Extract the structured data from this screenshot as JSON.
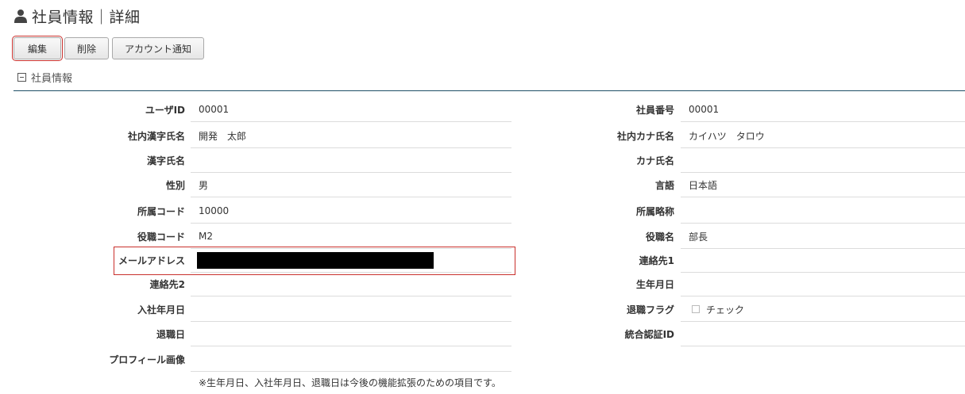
{
  "header": {
    "title": "社員情報｜詳細",
    "icon": "user-icon"
  },
  "toolbar": {
    "edit_label": "編集",
    "delete_label": "削除",
    "notify_label": "アカウント通知"
  },
  "section": {
    "label": "社員情報",
    "icon": "collapse-minus-icon"
  },
  "left_fields": [
    {
      "label": "ユーザID",
      "value": "00001"
    },
    {
      "label": "社内漢字氏名",
      "value": "開発　太郎"
    },
    {
      "label": "漢字氏名",
      "value": ""
    },
    {
      "label": "性別",
      "value": "男"
    },
    {
      "label": "所属コード",
      "value": "10000"
    },
    {
      "label": "役職コード",
      "value": "M2"
    },
    {
      "label": "メールアドレス",
      "value": ""
    },
    {
      "label": "連絡先2",
      "value": ""
    },
    {
      "label": "入社年月日",
      "value": ""
    },
    {
      "label": "退職日",
      "value": ""
    },
    {
      "label": "プロフィール画像",
      "value": ""
    }
  ],
  "right_fields": [
    {
      "label": "社員番号",
      "value": "00001"
    },
    {
      "label": "社内カナ氏名",
      "value": "カイハツ　タロウ"
    },
    {
      "label": "カナ氏名",
      "value": ""
    },
    {
      "label": "言語",
      "value": "日本語"
    },
    {
      "label": "所属略称",
      "value": ""
    },
    {
      "label": "役職名",
      "value": "部長"
    },
    {
      "label": "連絡先1",
      "value": ""
    },
    {
      "label": "生年月日",
      "value": ""
    },
    {
      "label": "退職フラグ",
      "value": "チェック"
    },
    {
      "label": "統合認証ID",
      "value": ""
    }
  ],
  "note": "※生年月日、入社年月日、退職日は今後の機能拡張のための項目です。",
  "colors": {
    "accent_rule": "#1e4f66",
    "highlight": "#c9302c"
  }
}
